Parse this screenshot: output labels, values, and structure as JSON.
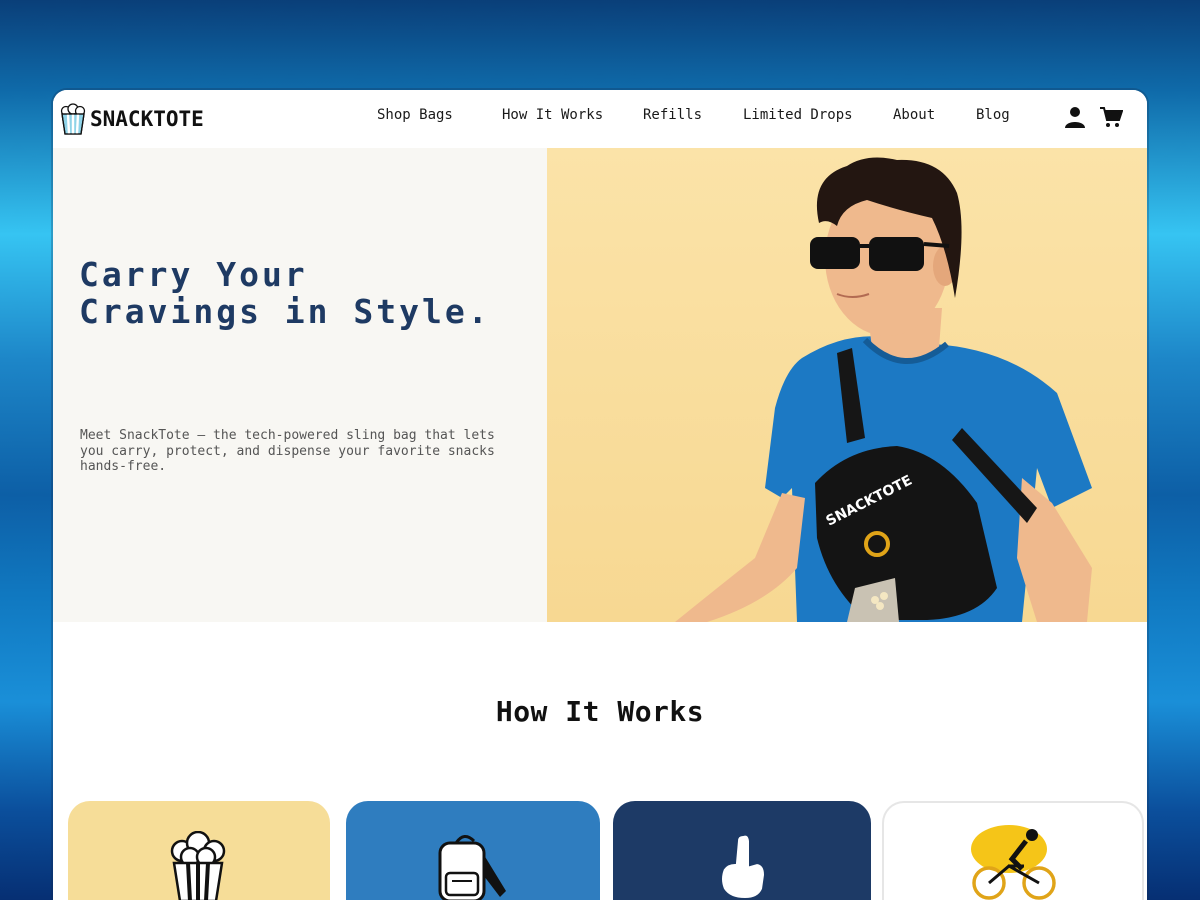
{
  "brand": {
    "name": "SNACKTOTE",
    "logo_icon": "popcorn-icon"
  },
  "nav": {
    "items": [
      {
        "label": "Shop Bags"
      },
      {
        "label": "How It Works"
      },
      {
        "label": "Refills"
      },
      {
        "label": "Limited Drops"
      },
      {
        "label": "About"
      },
      {
        "label": "Blog"
      }
    ]
  },
  "header_icons": {
    "account": "user-icon",
    "cart": "cart-icon"
  },
  "hero": {
    "title": "Carry Your Cravings in Style.",
    "description": "Meet SnackTote — the tech-powered sling bag that lets you carry, protect, and dispense your favorite snacks hands-free.",
    "image_bag_text": "SNACKTOTE",
    "background_color": "#f8f7f3",
    "image_background_color": "#f9dc9a"
  },
  "how_it_works": {
    "title": "How It Works",
    "cards": [
      {
        "icon": "popcorn-icon",
        "color": "#f6dd98"
      },
      {
        "icon": "backpack-icon",
        "color": "#2f7dbf"
      },
      {
        "icon": "pointing-hand-icon",
        "color": "#1d3a66"
      },
      {
        "icon": "cyclist-icon",
        "color": "#ffffff"
      }
    ]
  },
  "colors": {
    "accent": "#1e3a63",
    "title": "#1e3a63"
  }
}
